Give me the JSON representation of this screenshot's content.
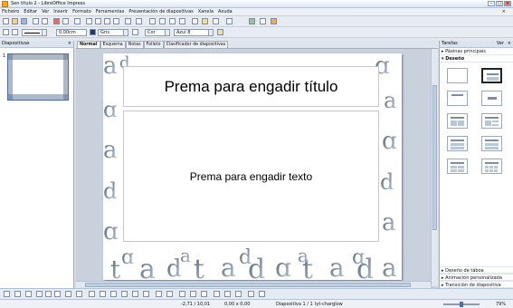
{
  "window": {
    "title": "Sen título 2 - LibreOffice Impress"
  },
  "menu": [
    "Ficheiro",
    "Editar",
    "Ver",
    "Inserir",
    "Formato",
    "Ferramentas",
    "Presentación de diapositivas",
    "Xanela",
    "Axuda"
  ],
  "toolbar": {
    "line_width": "0,00cm",
    "area_fill_type": "Gris",
    "area_color_mode": "Cor",
    "area_color": "Azul 8"
  },
  "slides_panel": {
    "title": "Diapositivas",
    "slide_number": "1"
  },
  "view_tabs": [
    "Normal",
    "Esquema",
    "Notas",
    "Folleto",
    "Clasificador de diapositivas"
  ],
  "slide": {
    "title_placeholder": "Prema para engadir título",
    "body_placeholder": "Prema para engadir texto"
  },
  "tasks_panel": {
    "title": "Tarefas",
    "view_label": "Ver",
    "sections_top": [
      "Páxinas principais",
      "Deseño"
    ],
    "sections_bottom": [
      "Deseño de táboa",
      "Animación personalizada",
      "Transición de diapositiva"
    ]
  },
  "statusbar": {
    "position": "-2,71 / 10,01",
    "size": "0,00 x 0,00",
    "slide_info": "Diapositiva 1 / 1",
    "master": "lyt-charglow",
    "zoom": "79%"
  },
  "colors": {
    "accent": "#4a6fa5",
    "panel": "#dbe3ee",
    "bg": "#c9d1dc"
  }
}
